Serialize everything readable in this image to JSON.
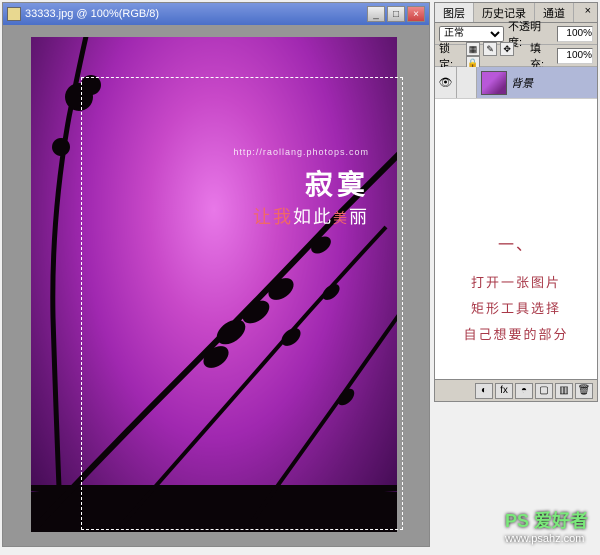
{
  "window": {
    "title": "33333.jpg @ 100%(RGB/8)",
    "controls": {
      "min": "_",
      "max": "□",
      "close": "×"
    }
  },
  "artwork": {
    "url_text": "http://raollang.photops.com",
    "line1": "寂寞",
    "line2_a": "让我",
    "line2_b": "如此",
    "line2_c": "美",
    "line2_d": "丽"
  },
  "panels": {
    "tabs": {
      "layers": "图层",
      "history": "历史记录",
      "channels": "通道"
    },
    "close": "×",
    "blend_mode": "正常",
    "opacity_label": "不透明度:",
    "opacity_value": "100%",
    "lock_label": "锁定:",
    "fill_label": "填充:",
    "fill_value": "100%",
    "layer": {
      "name": "背景",
      "eye": "👁"
    },
    "footer_icons": [
      "◐",
      "fx",
      "◓",
      "▢",
      "▥",
      "🗑"
    ]
  },
  "instructions": {
    "num": "一、",
    "line1": "打开一张图片",
    "line2": "矩形工具选择",
    "line3": "自己想要的部分"
  },
  "watermark": {
    "logo": "PS 爱好者",
    "domain": "www.psahz.com"
  }
}
